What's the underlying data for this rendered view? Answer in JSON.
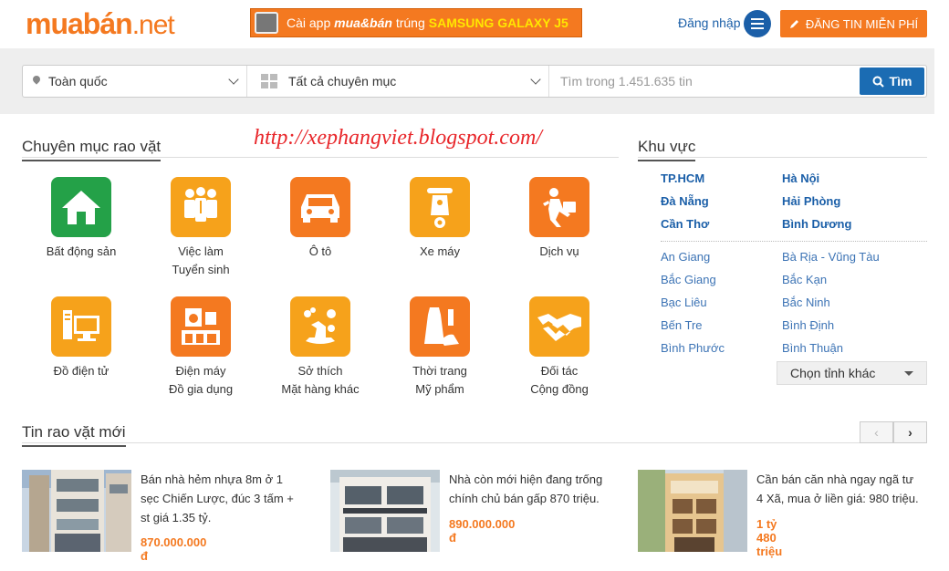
{
  "header": {
    "logo_part1": "muabán",
    "logo_part2": ".net",
    "banner_text": "Cài app",
    "banner_brand": "mua&bán",
    "banner_text2": "trúng",
    "banner_prize": "SAMSUNG GALAXY J5",
    "login_label": "Đăng nhập",
    "post_button_label": "ĐĂNG TIN MIỄN PHÍ"
  },
  "search": {
    "location_value": "Toàn quốc",
    "category_value": "Tất cả chuyên mục",
    "placeholder": "Tìm trong 1.451.635 tin",
    "button_label": "Tìm"
  },
  "watermark": "http://xephangviet.blogspot.com/",
  "categories": {
    "title": "Chuyên mục rao vặt",
    "items": [
      {
        "line1": "Bất động sản",
        "line2": "",
        "icon": "house-icon",
        "color": "#24a148"
      },
      {
        "line1": "Việc làm",
        "line2": "Tuyển sinh",
        "icon": "people-icon",
        "color": "#f6a21b"
      },
      {
        "line1": "Ô tô",
        "line2": "",
        "icon": "car-icon",
        "color": "#f47920"
      },
      {
        "line1": "Xe máy",
        "line2": "",
        "icon": "scooter-icon",
        "color": "#f6a21b"
      },
      {
        "line1": "Dịch vụ",
        "line2": "",
        "icon": "service-icon",
        "color": "#f47920"
      },
      {
        "line1": "Đồ điện tử",
        "line2": "",
        "icon": "computer-icon",
        "color": "#f6a21b"
      },
      {
        "line1": "Điện máy",
        "line2": "Đồ gia dụng",
        "icon": "appliance-icon",
        "color": "#f47920"
      },
      {
        "line1": "Sở thích",
        "line2": "Mặt hàng khác",
        "icon": "hobby-icon",
        "color": "#f6a21b"
      },
      {
        "line1": "Thời trang",
        "line2": "Mỹ phẩm",
        "icon": "fashion-icon",
        "color": "#f47920"
      },
      {
        "line1": "Đối tác",
        "line2": "Cộng đồng",
        "icon": "handshake-icon",
        "color": "#f6a21b"
      }
    ]
  },
  "region": {
    "title": "Khu vực",
    "major": [
      "TP.HCM",
      "Hà Nội",
      "Đà Nẵng",
      "Hải Phòng",
      "Cần Thơ",
      "Bình Dương"
    ],
    "provinces": [
      "An Giang",
      "Bà Rịa - Vũng Tàu",
      "Bắc Giang",
      "Bắc Kạn",
      "Bạc Liêu",
      "Bắc Ninh",
      "Bến Tre",
      "Bình Định",
      "Bình Phước",
      "Bình Thuận"
    ],
    "select_label": "Chọn tỉnh khác"
  },
  "listings": {
    "title": "Tin rao vặt mới",
    "prev_label": "‹",
    "next_label": "›",
    "items": [
      {
        "desc1": "Bán nhà hẻm nhựa 8m ở 1",
        "desc2": "sẹc Chiến Lược, đúc 3 tấm +",
        "desc3": "st giá 1.35 tỷ.",
        "price": "870.000.000 đ"
      },
      {
        "desc1": "Nhà còn mới hiện đang trống",
        "desc2": "chính chủ bán gấp 870 triệu.",
        "desc3": "",
        "price": "890.000.000 đ"
      },
      {
        "desc1": "Cần bán căn nhà ngay ngã tư",
        "desc2": "4 Xã, mua ở liền giá: 980 triệu.",
        "desc3": "",
        "price": "1 tỷ 480 triệu"
      }
    ]
  }
}
